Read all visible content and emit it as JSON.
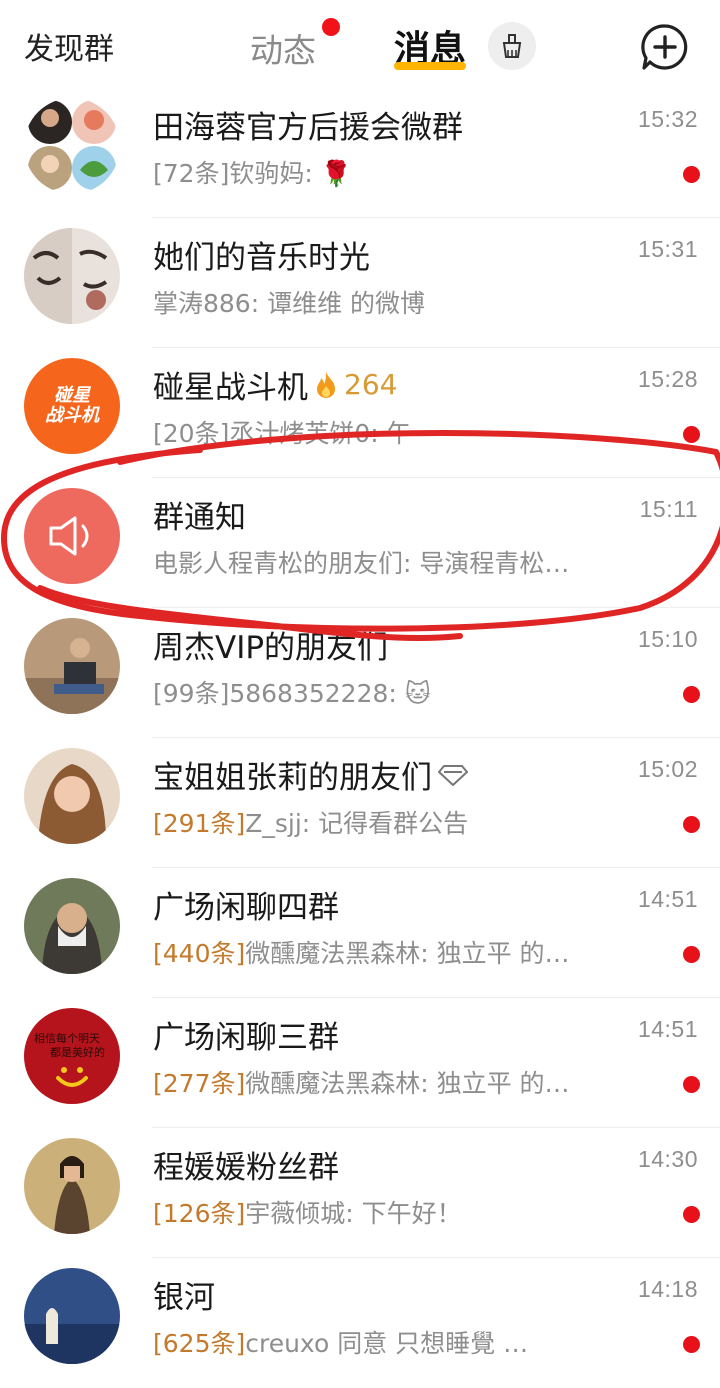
{
  "topbar": {
    "discover_label": "发现群",
    "tab_dynamic": "动态",
    "tab_messages": "消息"
  },
  "conversations": [
    {
      "title": "田海蓉官方后援会微群",
      "time": "15:32",
      "count": "[72条]",
      "sender": "钦驹妈: ",
      "message": "🌹",
      "unread": true,
      "count_highlight": false
    },
    {
      "title": "她们的音乐时光",
      "time": "15:31",
      "count": "",
      "sender": "掌涛886: ",
      "message": "谭维维 的微博",
      "unread": false,
      "count_highlight": false
    },
    {
      "title": "碰星战斗机",
      "heat": "264",
      "time": "15:28",
      "count": "[20条]",
      "sender": "丞汁烤芙饼0: ",
      "message": "午",
      "unread": true,
      "count_highlight": false
    },
    {
      "title": "群通知",
      "time": "15:11",
      "count": "",
      "sender": "电影人程青松的朋友们: ",
      "message": "导演程青松…",
      "unread": false,
      "count_highlight": false
    },
    {
      "title": "周杰VIP的朋友们",
      "time": "15:10",
      "count": "[99条]",
      "sender": "5868352228: ",
      "message": "🐱",
      "unread": true,
      "count_highlight": false
    },
    {
      "title": "宝姐姐张莉的朋友们",
      "time": "15:02",
      "count": "[291条]",
      "sender": "Z_sjj: ",
      "message": "记得看群公告",
      "unread": true,
      "count_highlight": true
    },
    {
      "title": "广场闲聊四群",
      "time": "14:51",
      "count": "[440条]",
      "sender": "微醺魔法黑森林: ",
      "message": "独立平 的…",
      "unread": true,
      "count_highlight": true
    },
    {
      "title": "广场闲聊三群",
      "time": "14:51",
      "count": "[277条]",
      "sender": "微醺魔法黑森林: ",
      "message": "独立平 的…",
      "unread": true,
      "count_highlight": true
    },
    {
      "title": "程媛媛粉丝群",
      "time": "14:30",
      "count": "[126条]",
      "sender": "宇薇倾城: ",
      "message": "下午好！",
      "unread": true,
      "count_highlight": true
    },
    {
      "title": "银河",
      "time": "14:18",
      "count": "[625条]",
      "sender": "creuxo 同意",
      "message": "     只想睡覺 …",
      "unread": true,
      "count_highlight": true
    }
  ],
  "avatars": {
    "row3_text_line1": "碰星",
    "row3_text_line2": "战斗机",
    "row8_text_line1": "相信每个明天",
    "row8_text_line2": "都是美好的"
  },
  "colors": {
    "accent": "#ffb400",
    "unread": "#e8111a",
    "count_highlight": "#c47a2c",
    "notice_avatar": "#ee6a5f",
    "annotation": "#e02525"
  }
}
